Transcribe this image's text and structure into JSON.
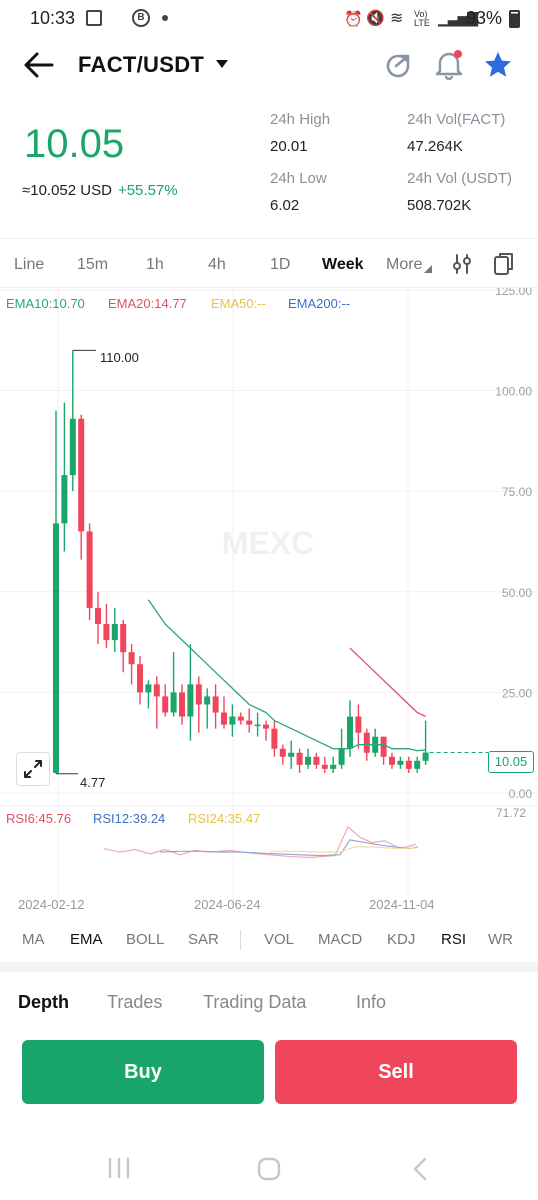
{
  "status_bar": {
    "time": "10:33",
    "battery": "93%",
    "net_label": "Vo) LTE"
  },
  "header": {
    "pair": "FACT/USDT"
  },
  "price": {
    "last": "10.05",
    "usd_approx": "≈10.052 USD",
    "change": "+55.57%"
  },
  "stats": {
    "high_label": "24h High",
    "high_value": "20.01",
    "low_label": "24h Low",
    "low_value": "6.02",
    "vol_base_label": "24h Vol(FACT)",
    "vol_base_value": "47.264K",
    "vol_quote_label": "24h Vol (USDT)",
    "vol_quote_value": "508.702K"
  },
  "timeframes": [
    "Line",
    "15m",
    "1h",
    "4h",
    "1D",
    "Week",
    "More"
  ],
  "active_timeframe": "Week",
  "ema_legend": {
    "ema10": "EMA10:10.70",
    "ema20": "EMA20:14.77",
    "ema50": "EMA50:--",
    "ema200": "EMA200:--"
  },
  "watermark": "MEXC",
  "price_axis": [
    "125.00",
    "100.00",
    "75.00",
    "50.00",
    "25.00",
    "0.00"
  ],
  "annotations": {
    "max": "110.00",
    "min": "4.77",
    "current": "10.05"
  },
  "rsi_legend": {
    "rsi6": "RSI6:45.76",
    "rsi12": "RSI12:39.24",
    "rsi24": "RSI24:35.47",
    "top": "71.72"
  },
  "date_axis": [
    "2024-02-12",
    "2024-06-24",
    "2024-11-04"
  ],
  "indicators": [
    "MA",
    "EMA",
    "BOLL",
    "SAR",
    "VOL",
    "MACD",
    "KDJ",
    "RSI",
    "WR"
  ],
  "bottom_tabs": [
    "Depth",
    "Trades",
    "Trading Data",
    "Info"
  ],
  "actions": {
    "buy": "Buy",
    "sell": "Sell"
  },
  "colors": {
    "up": "#1aa56a",
    "down": "#f0465c",
    "ema10": "#27a87a",
    "ema20": "#e0505e",
    "ema50": "#e7c04f",
    "ema200": "#3f6fc7",
    "accent_star": "#2f6ae0"
  },
  "chart_data": {
    "type": "candlestick",
    "price_range": [
      0,
      125
    ],
    "candles": [
      {
        "o": 5,
        "c": 67,
        "h": 95,
        "l": 4.77
      },
      {
        "o": 67,
        "c": 79,
        "h": 97,
        "l": 60
      },
      {
        "o": 79,
        "c": 93,
        "h": 110,
        "l": 75
      },
      {
        "o": 93,
        "c": 65,
        "h": 94,
        "l": 58
      },
      {
        "o": 65,
        "c": 46,
        "h": 67,
        "l": 43
      },
      {
        "o": 46,
        "c": 42,
        "h": 50,
        "l": 37
      },
      {
        "o": 42,
        "c": 38,
        "h": 47,
        "l": 36
      },
      {
        "o": 38,
        "c": 42,
        "h": 46,
        "l": 35
      },
      {
        "o": 42,
        "c": 35,
        "h": 43,
        "l": 30
      },
      {
        "o": 35,
        "c": 32,
        "h": 37,
        "l": 27
      },
      {
        "o": 32,
        "c": 25,
        "h": 34,
        "l": 22
      },
      {
        "o": 25,
        "c": 27,
        "h": 28,
        "l": 21
      },
      {
        "o": 27,
        "c": 24,
        "h": 29,
        "l": 16
      },
      {
        "o": 24,
        "c": 20,
        "h": 27,
        "l": 19
      },
      {
        "o": 20,
        "c": 25,
        "h": 35,
        "l": 19
      },
      {
        "o": 25,
        "c": 19,
        "h": 27,
        "l": 17
      },
      {
        "o": 19,
        "c": 27,
        "h": 37,
        "l": 13
      },
      {
        "o": 27,
        "c": 22,
        "h": 29,
        "l": 15
      },
      {
        "o": 22,
        "c": 24,
        "h": 26,
        "l": 16
      },
      {
        "o": 24,
        "c": 20,
        "h": 27,
        "l": 16
      },
      {
        "o": 20,
        "c": 17,
        "h": 24,
        "l": 16
      },
      {
        "o": 17,
        "c": 19,
        "h": 22,
        "l": 14
      },
      {
        "o": 19,
        "c": 18,
        "h": 20,
        "l": 17
      },
      {
        "o": 18,
        "c": 17,
        "h": 21,
        "l": 15
      },
      {
        "o": 17,
        "c": 17,
        "h": 20,
        "l": 14
      },
      {
        "o": 17,
        "c": 16,
        "h": 18,
        "l": 13
      },
      {
        "o": 16,
        "c": 11,
        "h": 18,
        "l": 9
      },
      {
        "o": 11,
        "c": 9,
        "h": 12,
        "l": 7
      },
      {
        "o": 9,
        "c": 10,
        "h": 13,
        "l": 6
      },
      {
        "o": 10,
        "c": 7,
        "h": 11,
        "l": 5
      },
      {
        "o": 7,
        "c": 9,
        "h": 11,
        "l": 6
      },
      {
        "o": 9,
        "c": 7,
        "h": 10,
        "l": 6
      },
      {
        "o": 7,
        "c": 6,
        "h": 9,
        "l": 5
      },
      {
        "o": 6,
        "c": 7,
        "h": 9,
        "l": 5
      },
      {
        "o": 7,
        "c": 11,
        "h": 16,
        "l": 6
      },
      {
        "o": 11,
        "c": 19,
        "h": 23,
        "l": 9
      },
      {
        "o": 19,
        "c": 15,
        "h": 22,
        "l": 11
      },
      {
        "o": 15,
        "c": 10,
        "h": 16,
        "l": 8
      },
      {
        "o": 10,
        "c": 14,
        "h": 16,
        "l": 9
      },
      {
        "o": 14,
        "c": 9,
        "h": 14,
        "l": 7
      },
      {
        "o": 9,
        "c": 7,
        "h": 10,
        "l": 6
      },
      {
        "o": 7,
        "c": 8,
        "h": 9,
        "l": 6
      },
      {
        "o": 8,
        "c": 6,
        "h": 9,
        "l": 5
      },
      {
        "o": 6,
        "c": 8,
        "h": 9,
        "l": 5
      },
      {
        "o": 8,
        "c": 10.05,
        "h": 18,
        "l": 7
      }
    ],
    "ema10": [
      null,
      null,
      null,
      null,
      null,
      null,
      null,
      null,
      null,
      null,
      null,
      48,
      45,
      42,
      40,
      38,
      36,
      34,
      32,
      30,
      28,
      26,
      24,
      22,
      21,
      20,
      18,
      17,
      16,
      15,
      14,
      13,
      12,
      11,
      11,
      11,
      12,
      12,
      12,
      12,
      11,
      11,
      11,
      10.5,
      10.7
    ],
    "ema20": [
      null,
      null,
      null,
      null,
      null,
      null,
      null,
      null,
      null,
      null,
      null,
      null,
      null,
      null,
      null,
      null,
      null,
      null,
      null,
      null,
      null,
      null,
      null,
      null,
      null,
      null,
      null,
      null,
      null,
      null,
      null,
      null,
      null,
      null,
      null,
      36,
      34,
      32,
      30,
      28,
      26,
      24,
      22,
      20,
      19,
      18,
      17,
      16,
      15,
      14.77
    ]
  }
}
